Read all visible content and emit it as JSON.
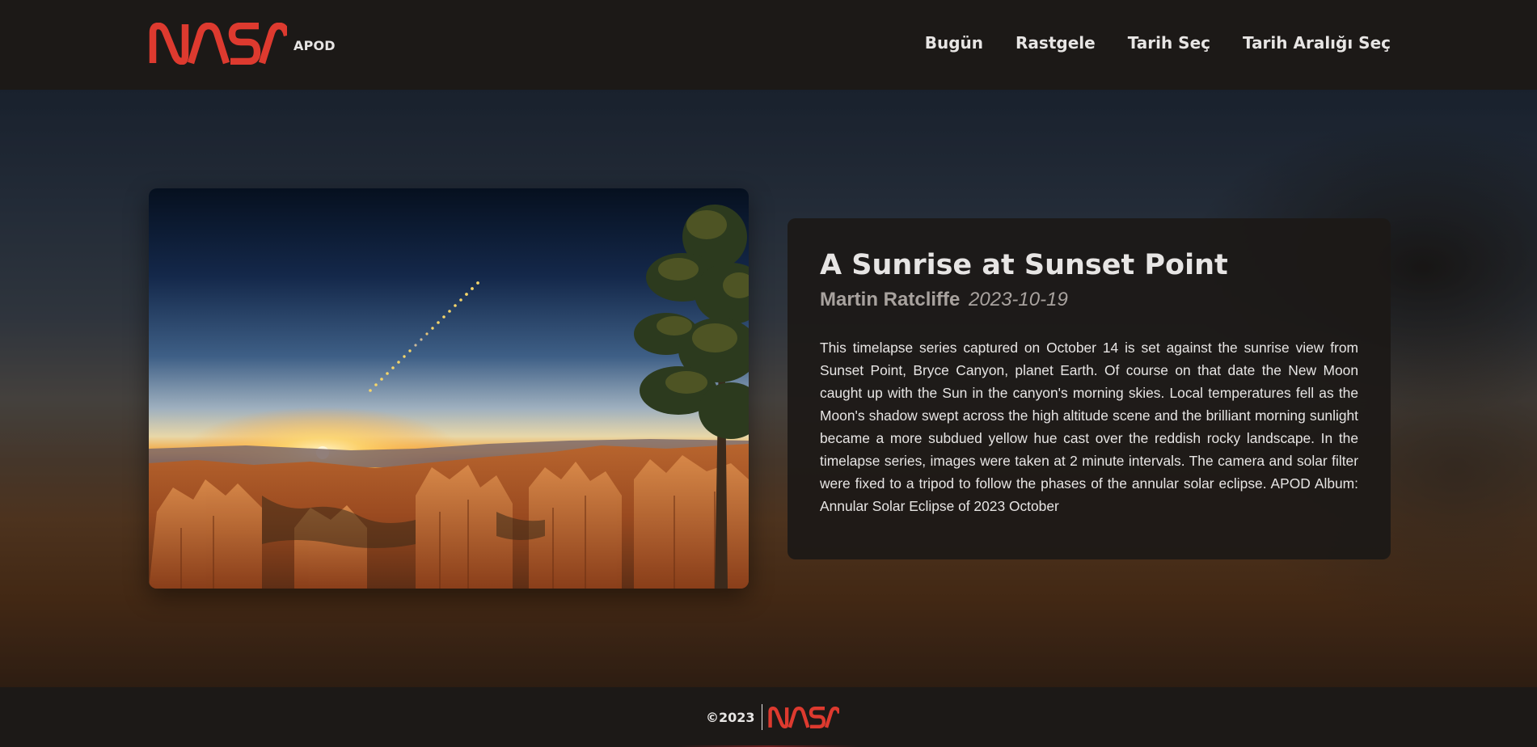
{
  "header": {
    "logo_text": "NASA",
    "app_label": "APOD",
    "nav": [
      {
        "label": "Bugün"
      },
      {
        "label": "Rastgele"
      },
      {
        "label": "Tarih Seç"
      },
      {
        "label": "Tarih Aralığı Seç"
      }
    ]
  },
  "apod": {
    "title": "A Sunrise at Sunset Point",
    "author": "Martin Ratcliffe",
    "date": "2023-10-19",
    "explanation": "This timelapse series captured on October 14 is set against the sunrise view from Sunset Point, Bryce Canyon, planet Earth. Of course on that date the New Moon caught up with the Sun in the canyon's morning skies. Local temperatures fell as the Moon's shadow swept across the high altitude scene and the brilliant morning sunlight became a more subdued yellow hue cast over the reddish rocky landscape. In the timelapse series, images were taken at 2 minute intervals. The camera and solar filter were fixed to a tripod to follow the phases of the annular solar eclipse. APOD Album: Annular Solar Eclipse of 2023 October"
  },
  "footer": {
    "copyright": "©2023",
    "logo_text": "NASA"
  },
  "colors": {
    "brand_red": "#dd3a2f",
    "header_bg": "#1c1917",
    "text": "#e7e5e4",
    "muted": "#a8a29e"
  }
}
